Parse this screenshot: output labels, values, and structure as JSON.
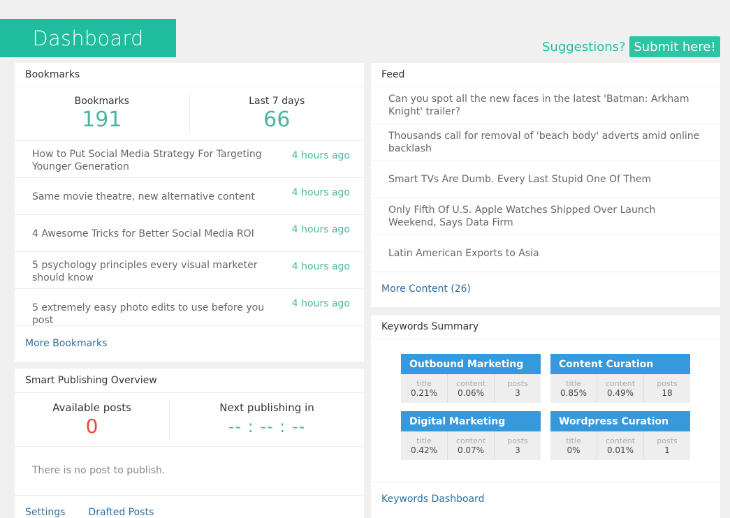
{
  "header": {
    "title": "Dashboard",
    "suggestions_text": "Suggestions?",
    "submit_label": "Submit here!"
  },
  "bookmarks_panel": {
    "title": "Bookmarks",
    "stats": [
      {
        "label": "Bookmarks",
        "value": "191"
      },
      {
        "label": "Last 7 days",
        "value": "66"
      }
    ],
    "items": [
      {
        "title": "How to Put Social Media Strategy For Targeting Younger Generation",
        "time": "4 hours ago"
      },
      {
        "title": "Same movie theatre, new alternative content",
        "time": "4 hours ago"
      },
      {
        "title": "4 Awesome Tricks for Better Social Media ROI",
        "time": "4 hours ago"
      },
      {
        "title": "5 psychology principles every visual marketer should know",
        "time": "4 hours ago"
      },
      {
        "title": "5 extremely easy photo edits to use before you post",
        "time": "4 hours ago"
      }
    ],
    "more_label": "More Bookmarks"
  },
  "smart_publishing": {
    "title": "Smart Publishing Overview",
    "available_label": "Available posts",
    "available_value": "0",
    "next_label": "Next publishing in",
    "next_value": "-- : -- : --",
    "empty_text": "There is no post to publish.",
    "links": [
      "Settings",
      "Drafted Posts"
    ]
  },
  "feed_panel": {
    "title": "Feed",
    "items": [
      "Can you spot all the new faces in the latest 'Batman: Arkham Knight' trailer?",
      "Thousands call for removal of 'beach body' adverts amid online backlash",
      "Smart TVs Are Dumb. Every Last Stupid One Of Them",
      "Only Fifth Of U.S. Apple Watches Shipped Over Launch Weekend, Says Data Firm",
      "Latin American Exports to Asia"
    ],
    "more_label": "More Content (26)"
  },
  "keywords_panel": {
    "title": "Keywords Summary",
    "metric_labels": {
      "title": "title",
      "content": "content",
      "posts": "posts"
    },
    "keywords": [
      {
        "name": "Outbound Marketing",
        "title": "0.21%",
        "content": "0.06%",
        "posts": "3"
      },
      {
        "name": "Content Curation",
        "title": "0.85%",
        "content": "0.49%",
        "posts": "18"
      },
      {
        "name": "Digital Marketing",
        "title": "0.42%",
        "content": "0.07%",
        "posts": "3"
      },
      {
        "name": "Wordpress Curation",
        "title": "0%",
        "content": "0.01%",
        "posts": "1"
      }
    ],
    "dashboard_link": "Keywords Dashboard"
  },
  "colors": {
    "accent_green": "#1fbd9d",
    "keyword_blue": "#3699dc",
    "link_blue": "#2e6e9e",
    "alert_red": "#e24c3b"
  }
}
